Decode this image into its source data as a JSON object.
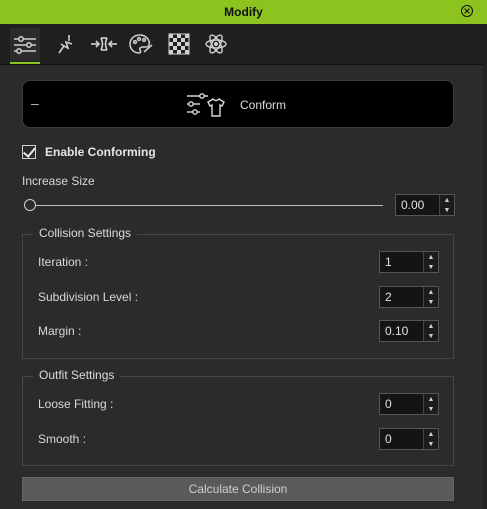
{
  "titlebar": {
    "title": "Modify",
    "close_glyph": "⨯"
  },
  "tabs": [
    {
      "name": "modify-tab",
      "icon": "sliders-icon",
      "active": true
    },
    {
      "name": "motion-tab",
      "icon": "running-figure-icon",
      "active": false
    },
    {
      "name": "compress-tab",
      "icon": "compress-arrows-icon",
      "active": false
    },
    {
      "name": "material-tab",
      "icon": "palette-icon",
      "active": false
    },
    {
      "name": "texture-tab",
      "icon": "checker-icon",
      "active": false
    },
    {
      "name": "physics-tab",
      "icon": "atom-icon",
      "active": false
    }
  ],
  "conform": {
    "collapse_glyph": "–",
    "label": "Conform",
    "icon": "shirt-sliders-icon"
  },
  "enable_conforming": {
    "label": "Enable Conforming",
    "checked": true
  },
  "increase_size": {
    "label": "Increase Size",
    "value": "0.00",
    "slider_fraction": 0
  },
  "collision_settings": {
    "title": "Collision Settings",
    "iteration": {
      "label": "Iteration :",
      "value": "1"
    },
    "subdivision": {
      "label": "Subdivision Level :",
      "value": "2"
    },
    "margin": {
      "label": "Margin :",
      "value": "0.10"
    }
  },
  "outfit_settings": {
    "title": "Outfit Settings",
    "loose_fitting": {
      "label": "Loose Fitting :",
      "value": "0"
    },
    "smooth": {
      "label": "Smooth :",
      "value": "0"
    }
  },
  "calculate_collision": {
    "label": "Calculate Collision"
  },
  "arrows": {
    "up": "▲",
    "down": "▼"
  },
  "colors": {
    "accent": "#8cc31e",
    "panel": "#2b2b2b",
    "header": "#000000"
  }
}
